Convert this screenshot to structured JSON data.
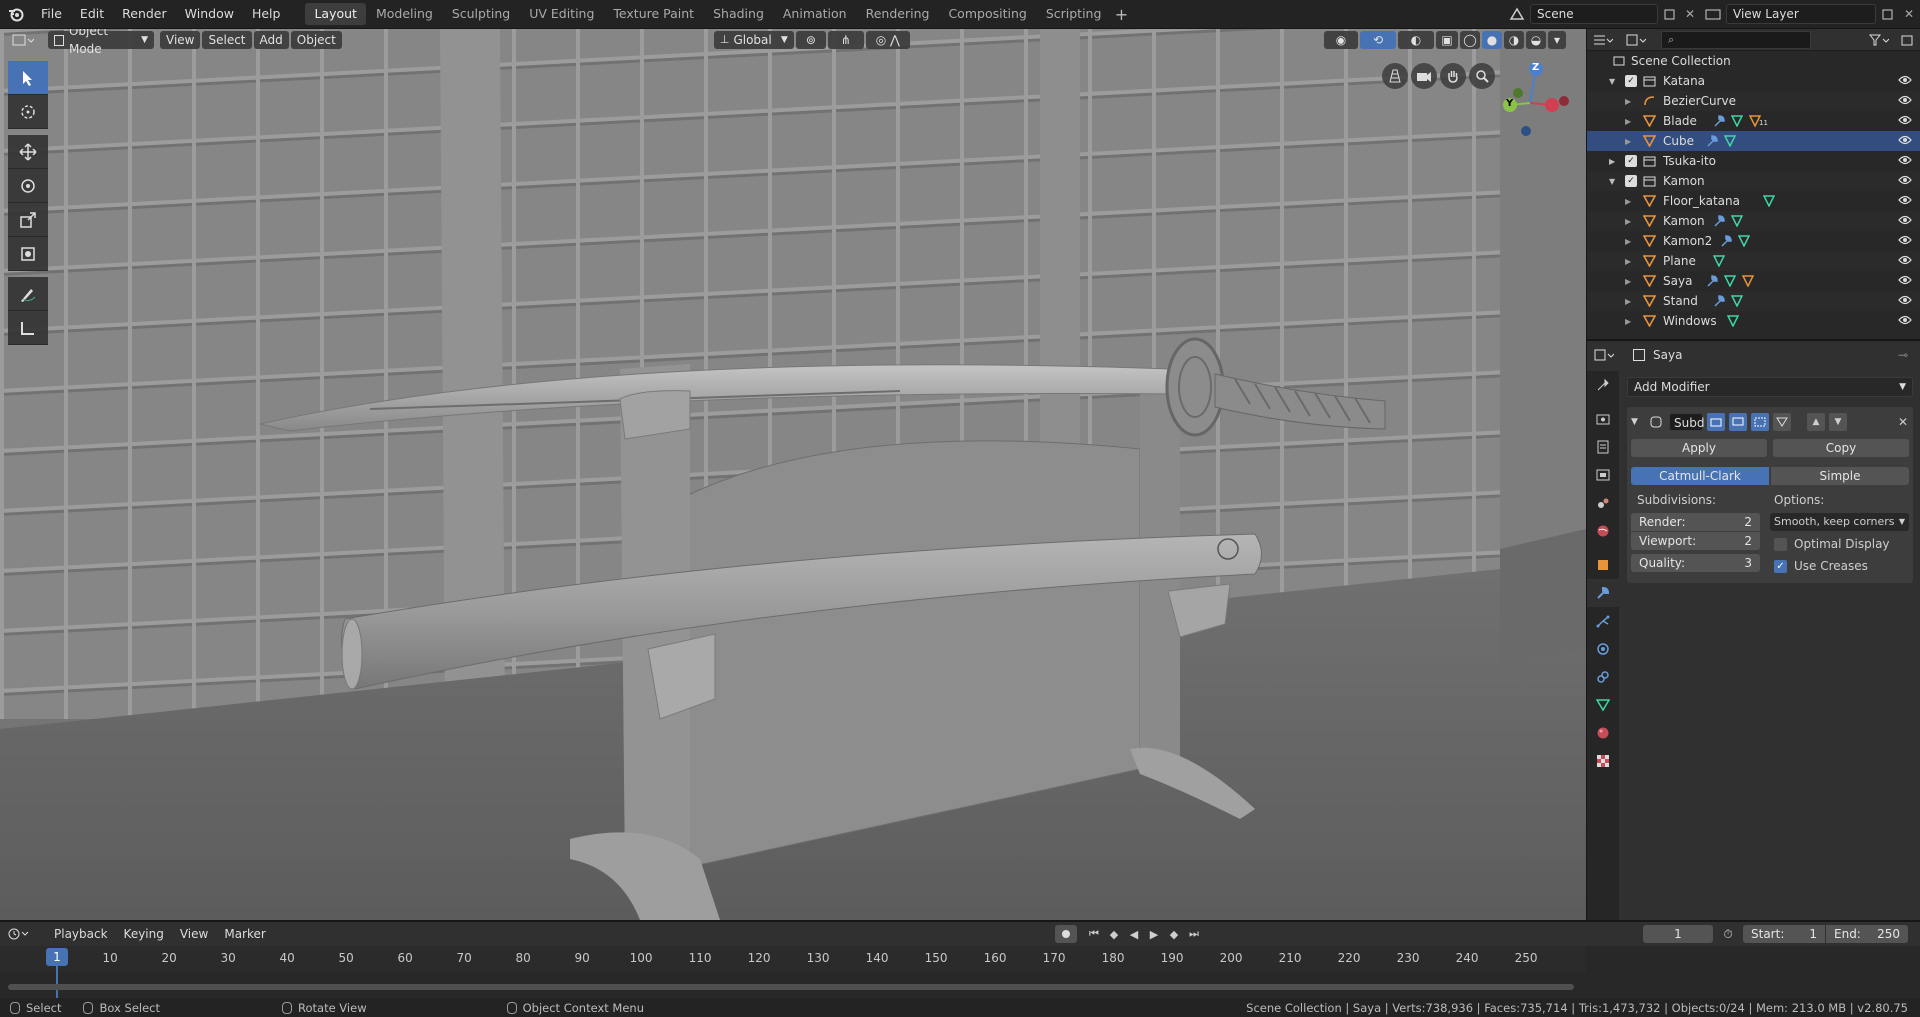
{
  "topbar": {
    "menus": [
      "File",
      "Edit",
      "Render",
      "Window",
      "Help"
    ],
    "workspaces": [
      "Layout",
      "Modeling",
      "Sculpting",
      "UV Editing",
      "Texture Paint",
      "Shading",
      "Animation",
      "Rendering",
      "Compositing",
      "Scripting"
    ],
    "active_workspace": "Layout",
    "add_workspace_icon": "plus-icon",
    "scene_name": "Scene",
    "view_layer": "View Layer"
  },
  "viewport": {
    "mode": "Object Mode",
    "menus": [
      "View",
      "Select",
      "Add",
      "Object"
    ],
    "orientation": "Global",
    "gizmo_axes": {
      "x": "X",
      "y": "Y",
      "z": "Z"
    },
    "tools": [
      "select-box-icon",
      "cursor-icon",
      "move-icon",
      "rotate-icon",
      "scale-icon",
      "transform-icon",
      "annotate-icon",
      "measure-icon"
    ]
  },
  "outliner": {
    "search_placeholder": "",
    "root": "Scene Collection",
    "rows": [
      {
        "name": "Katana",
        "type": "collection",
        "indent": 1,
        "expanded": true,
        "checked": true
      },
      {
        "name": "BezierCurve",
        "type": "curve",
        "indent": 2
      },
      {
        "name": "Blade",
        "type": "mesh",
        "indent": 2,
        "icons": [
          "modifier",
          "mesh",
          "vertex-group"
        ],
        "badge": "11"
      },
      {
        "name": "Cube",
        "type": "mesh",
        "indent": 2,
        "selected": true,
        "icons": [
          "modifier",
          "mesh"
        ]
      },
      {
        "name": "Tsuka-ito",
        "type": "collection",
        "indent": 1,
        "checked": true
      },
      {
        "name": "Kamon",
        "type": "collection",
        "indent": 1,
        "expanded": true,
        "checked": true
      },
      {
        "name": "Floor_katana",
        "type": "mesh",
        "indent": 2,
        "icons": [
          "mesh"
        ]
      },
      {
        "name": "Kamon",
        "type": "mesh",
        "indent": 2,
        "icons": [
          "modifier",
          "mesh"
        ]
      },
      {
        "name": "Kamon2",
        "type": "mesh",
        "indent": 2,
        "icons": [
          "modifier",
          "mesh"
        ]
      },
      {
        "name": "Plane",
        "type": "mesh",
        "indent": 2,
        "icons": [
          "mesh"
        ]
      },
      {
        "name": "Saya",
        "type": "mesh",
        "indent": 2,
        "icons": [
          "modifier",
          "mesh",
          "vertex-group"
        ]
      },
      {
        "name": "Stand",
        "type": "mesh",
        "indent": 2,
        "icons": [
          "modifier",
          "mesh"
        ]
      },
      {
        "name": "Windows",
        "type": "mesh",
        "indent": 2,
        "icons": [
          "mesh"
        ]
      }
    ]
  },
  "properties": {
    "object_name": "Saya",
    "add_modifier": "Add Modifier",
    "modifier_name": "Subd",
    "apply": "Apply",
    "copy": "Copy",
    "algo_catmull": "Catmull-Clark",
    "algo_simple": "Simple",
    "subdivisions_label": "Subdivisions:",
    "options_label": "Options:",
    "render_label": "Render:",
    "render_value": "2",
    "viewport_label": "Viewport:",
    "viewport_value": "2",
    "quality_label": "Quality:",
    "quality_value": "3",
    "uv_smooth": "Smooth, keep corners",
    "optimal_display": "Optimal Display",
    "optimal_display_checked": false,
    "use_creases": "Use Creases",
    "use_creases_checked": true
  },
  "timeline": {
    "menus": [
      "Playback",
      "Keying",
      "View",
      "Marker"
    ],
    "current_frame": "1",
    "start_label": "Start:",
    "start": "1",
    "end_label": "End:",
    "end": "250",
    "ticks": [
      "1",
      "10",
      "20",
      "30",
      "40",
      "50",
      "60",
      "70",
      "80",
      "90",
      "100",
      "110",
      "120",
      "130",
      "140",
      "150",
      "160",
      "170",
      "180",
      "190",
      "200",
      "210",
      "220",
      "230",
      "240",
      "250"
    ]
  },
  "statusbar": {
    "select": "Select",
    "box_select": "Box Select",
    "rotate_view": "Rotate View",
    "context_menu": "Object Context Menu",
    "stats": "Scene Collection | Saya | Verts:738,936 | Faces:735,714 | Tris:1,473,732 | Objects:0/24 | Mem: 213.0 MB | v2.80.75"
  },
  "colors": {
    "accent": "#4772b3",
    "mesh_icon": "#e8943a",
    "modifier_icon": "#6a9bdb",
    "mesh_data_icon": "#3fd6a8"
  }
}
